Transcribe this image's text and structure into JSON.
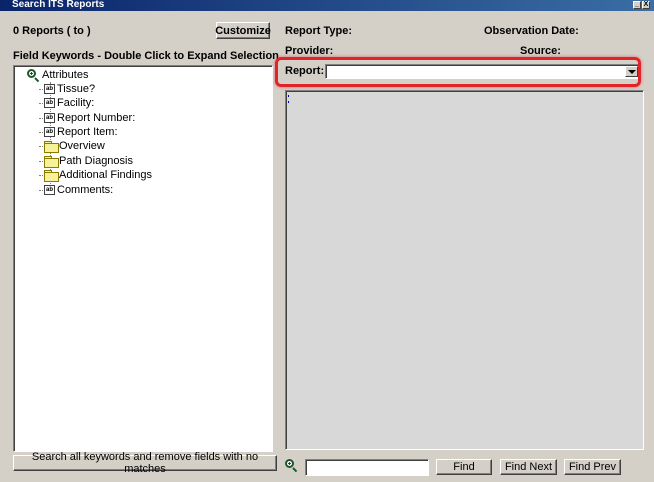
{
  "window": {
    "title": "Search ITS Reports",
    "controls": [
      "_",
      "X"
    ]
  },
  "left": {
    "report_count": "0 Reports  ( to )",
    "customize_label": "Customize",
    "field_keywords_heading": "Field Keywords - Double Click to Expand Selection",
    "tree": {
      "root": {
        "label": "Attributes",
        "icon": "magnifier-plus-icon"
      },
      "children": [
        {
          "label": "Tissue?",
          "type": "field",
          "icon_text": "ab"
        },
        {
          "label": "Facility:",
          "type": "field",
          "icon_text": "ab"
        },
        {
          "label": "Report Number:",
          "type": "field",
          "icon_text": "ab"
        },
        {
          "label": "Report Item:",
          "type": "field",
          "icon_text": "ab"
        },
        {
          "label": "Overview",
          "type": "folder"
        },
        {
          "label": "Path Diagnosis",
          "type": "folder"
        },
        {
          "label": "Additional Findings",
          "type": "folder"
        },
        {
          "label": "Comments:",
          "type": "field",
          "icon_text": "ab"
        }
      ]
    },
    "search_all_label": "Search all keywords and remove fields with no matches"
  },
  "right": {
    "report_type_label": "Report Type:",
    "observation_date_label": "Observation Date:",
    "provider_label": "Provider:",
    "source_label": "Source:",
    "report_label": "Report:",
    "report_value": ""
  },
  "find_bar": {
    "input_value": "",
    "find_label": "Find",
    "find_next_label": "Find Next",
    "find_prev_label": "Find Prev"
  },
  "colors": {
    "background": "#d4d0c8",
    "titlebar": "#0a246a",
    "highlight": "#e0242a",
    "folder": "#f7f29a"
  }
}
